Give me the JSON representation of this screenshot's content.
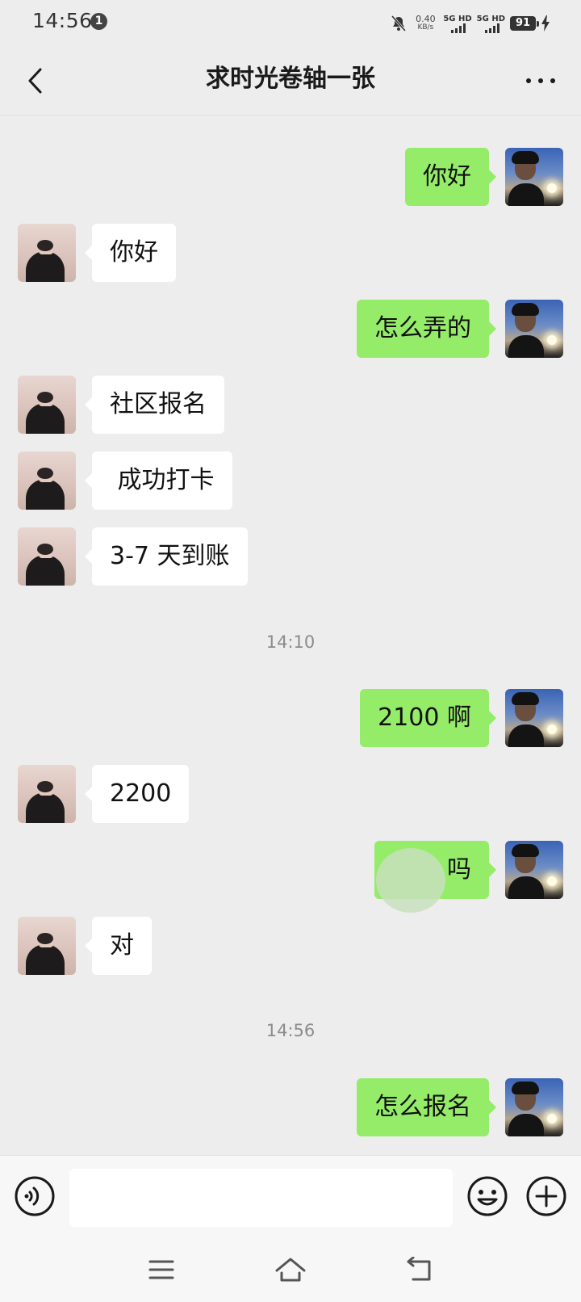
{
  "status_bar": {
    "time": "14:56",
    "notification_count": "1",
    "net_speed_value": "0.40",
    "net_speed_unit": "KB/s",
    "sim1_label": "5G HD",
    "sim2_label": "5G HD",
    "battery": "91"
  },
  "header": {
    "title": "求时光卷轴一张"
  },
  "messages": [
    {
      "from": "self",
      "text": "你好"
    },
    {
      "from": "other",
      "text": "你好"
    },
    {
      "from": "self",
      "text": "怎么弄的"
    },
    {
      "from": "other",
      "text": "社区报名"
    },
    {
      "from": "other",
      "text": " 成功打卡"
    },
    {
      "from": "other",
      "text": "3-7 天到账"
    },
    {
      "from": "self",
      "text": "2100 啊"
    },
    {
      "from": "other",
      "text": "2200"
    },
    {
      "from": "self",
      "text": "吗"
    },
    {
      "from": "other",
      "text": "对"
    },
    {
      "from": "self",
      "text": "怎么报名"
    }
  ],
  "timestamps": [
    "14:10",
    "14:56"
  ],
  "colors": {
    "self_bubble": "#95ec69",
    "other_bubble": "#ffffff",
    "background": "#ededed"
  },
  "input_bar": {
    "message_value": "",
    "voice_icon": "voice-icon",
    "emoji_icon": "emoji-icon",
    "plus_icon": "plus-icon"
  },
  "nav_bar": {
    "menu_icon": "menu-icon",
    "home_icon": "home-icon",
    "back_icon": "back-icon"
  }
}
